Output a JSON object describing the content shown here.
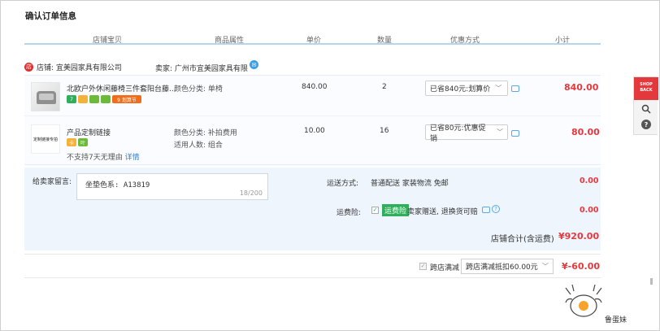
{
  "page_title": "确认订单信息",
  "columns": [
    "店铺宝贝",
    "商品属性",
    "单价",
    "数量",
    "优惠方式",
    "小计"
  ],
  "shop": {
    "icon": "shop-icon",
    "label": "店铺: 宜美园家具有限公司",
    "seller_label": "卖家: 广州市宜美园家具有限",
    "ww_icon": "chat-icon"
  },
  "items": [
    {
      "title": "北欧户外休闲藤椅三件套阳台藤...",
      "badges": [
        "7",
        "卡",
        "叶",
        "9 划算节"
      ],
      "props": [
        "颜色分类: 单椅"
      ],
      "price": "840.00",
      "qty": "2",
      "coupon": "已省840元:划算价",
      "subtotal": "840.00"
    },
    {
      "title": "产品定制链接",
      "thumb_text": "定制链接专拍",
      "badges": [
        "卡",
        "叶"
      ],
      "props": [
        "颜色分类: 补拍费用",
        "适用人数: 组合"
      ],
      "price": "10.00",
      "qty": "16",
      "coupon": "已省80元:优惠促销",
      "subtotal": "80.00",
      "no_return": "不支持7天无理由",
      "detail_link": "详情"
    }
  ],
  "extra": {
    "msg_label": "给卖家留言:",
    "msg_value": "坐垫色系: A13819",
    "msg_count": "18/200",
    "ship_label": "运送方式:",
    "ship_value": "普通配送 家装物流 免邮",
    "ship_amount": "0.00",
    "ins_label": "运费险:",
    "ins_tag": "运费险",
    "ins_text": "卖家赠送, 退换货可赔",
    "ins_amount": "0.00",
    "total_label": "店铺合计(含运费)",
    "total_value": "¥920.00"
  },
  "cross": {
    "label": "跨店满减",
    "select": "跨店满减抵扣60.00元",
    "amount": "¥-60.00"
  },
  "side": {
    "shop_back": "SHOP BACK",
    "help": "?"
  },
  "mascot_label": "鲁蛋妹",
  "colors": {
    "accent_red": "#e4393c",
    "link_blue": "#3a7ec8",
    "header_line": "#b7d4ef",
    "panel_bg": "#eef5fd"
  }
}
